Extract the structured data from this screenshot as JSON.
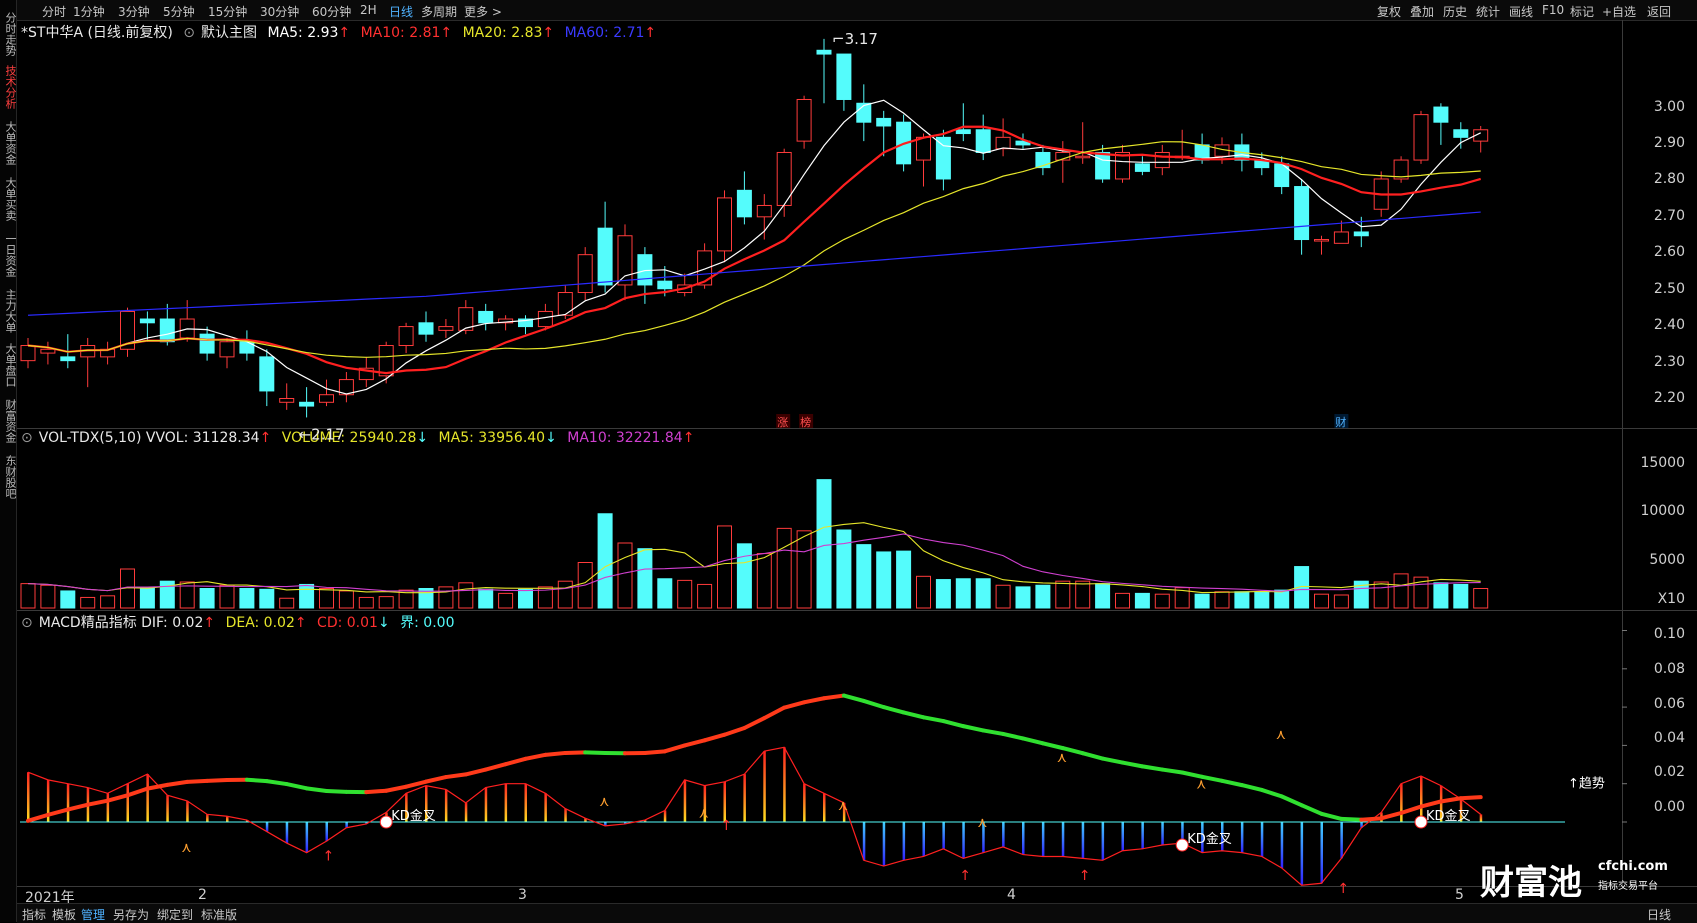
{
  "sidebar": {
    "items": [
      {
        "label": "分时走势",
        "active": false
      },
      {
        "label": "技术分析",
        "active": true
      },
      {
        "label": "大单资金",
        "active": false
      },
      {
        "label": "大单买卖",
        "active": false
      },
      {
        "label": "一日资金",
        "active": false
      },
      {
        "label": "主力大单",
        "active": false
      },
      {
        "label": "大单盘口",
        "active": false
      },
      {
        "label": "财富资金",
        "active": false
      },
      {
        "label": "东财股吧",
        "active": false
      }
    ]
  },
  "toolbar": {
    "periods": [
      "分时",
      "1分钟",
      "3分钟",
      "5分钟",
      "15分钟",
      "30分钟",
      "60分钟",
      "2H",
      "日线",
      "多周期",
      "更多 >"
    ],
    "active_period": "日线",
    "right_items": [
      "复权",
      "叠加",
      "历史",
      "统计",
      "画线",
      "F10",
      "标记",
      "+自选",
      "返回"
    ]
  },
  "main_chart": {
    "stock_title": "*ST中华A (日线.前复权)",
    "indicator_name": "默认主图",
    "ma5": "MA5: 2.93",
    "ma10": "MA10: 2.81",
    "ma20": "MA20: 2.83",
    "ma60": "MA60: 2.71",
    "high_label": "3.17",
    "low_label": "2.17",
    "markers": [
      "涨",
      "榜",
      "财"
    ],
    "y_ticks": [
      "3.00",
      "2.90",
      "2.80",
      "2.70",
      "2.60",
      "2.50",
      "2.40",
      "2.30",
      "2.20"
    ]
  },
  "volume_chart": {
    "indicator": "VOL-TDX(5,10) VVOL: 31128.34",
    "volume": "VOLUME: 25940.28",
    "ma5": "MA5: 33956.40",
    "ma10": "MA10: 32221.84",
    "y_ticks": [
      "15000",
      "10000",
      "5000",
      "X10"
    ]
  },
  "macd_chart": {
    "indicator": "MACD精品指标 DIF: 0.02",
    "dea": "DEA: 0.02",
    "cd": "CD: 0.01",
    "jie": "界: 0.00",
    "kd_label": "KD金叉",
    "trend_label": "趋势",
    "y_ticks": [
      "0.10",
      "0.08",
      "0.06",
      "0.04",
      "0.02",
      "0.00"
    ]
  },
  "time_axis": [
    "2021年",
    "2",
    "3",
    "4",
    "5"
  ],
  "bottombar": {
    "items": [
      "指标",
      "模板",
      "管理",
      "另存为",
      "绑定到",
      "标准版"
    ],
    "active": "管理",
    "period_label": "日线"
  },
  "watermark": {
    "brand": "财富池",
    "site": "cfchi.com",
    "tagline": "指标交易平台"
  },
  "colors": {
    "up": "#ff3b3b",
    "down": "#54fcfc",
    "ma5": "#ffffff",
    "ma10": "#ff2020",
    "ma20": "#e5e52a",
    "ma60": "#2a2aff",
    "vol_ma10": "#d040d0",
    "blue_label": "#4fb2ff"
  },
  "chart_data": {
    "type": "candlestick",
    "candles": [
      [
        2.32,
        2.36,
        2.38,
        2.3
      ],
      [
        2.34,
        2.35,
        2.37,
        2.31
      ],
      [
        2.33,
        2.32,
        2.39,
        2.3
      ],
      [
        2.33,
        2.36,
        2.38,
        2.25
      ],
      [
        2.33,
        2.35,
        2.37,
        2.31
      ],
      [
        2.35,
        2.45,
        2.46,
        2.33
      ],
      [
        2.43,
        2.42,
        2.45,
        2.37
      ],
      [
        2.43,
        2.37,
        2.47,
        2.36
      ],
      [
        2.38,
        2.43,
        2.48,
        2.37
      ],
      [
        2.39,
        2.34,
        2.41,
        2.32
      ],
      [
        2.33,
        2.37,
        2.38,
        2.3
      ],
      [
        2.37,
        2.34,
        2.4,
        2.32
      ],
      [
        2.33,
        2.24,
        2.35,
        2.2
      ],
      [
        2.21,
        2.22,
        2.26,
        2.19
      ],
      [
        2.21,
        2.2,
        2.25,
        2.17
      ],
      [
        2.21,
        2.23,
        2.27,
        2.2
      ],
      [
        2.23,
        2.27,
        2.29,
        2.21
      ],
      [
        2.27,
        2.3,
        2.33,
        2.25
      ],
      [
        2.28,
        2.36,
        2.37,
        2.26
      ],
      [
        2.36,
        2.41,
        2.42,
        2.34
      ],
      [
        2.42,
        2.39,
        2.45,
        2.37
      ],
      [
        2.4,
        2.41,
        2.43,
        2.38
      ],
      [
        2.4,
        2.46,
        2.48,
        2.39
      ],
      [
        2.45,
        2.42,
        2.47,
        2.4
      ],
      [
        2.42,
        2.43,
        2.44,
        2.4
      ],
      [
        2.43,
        2.41,
        2.44,
        2.39
      ],
      [
        2.41,
        2.45,
        2.47,
        2.4
      ],
      [
        2.44,
        2.5,
        2.52,
        2.43
      ],
      [
        2.5,
        2.6,
        2.62,
        2.48
      ],
      [
        2.67,
        2.52,
        2.74,
        2.5
      ],
      [
        2.52,
        2.65,
        2.68,
        2.48
      ],
      [
        2.6,
        2.52,
        2.62,
        2.47
      ],
      [
        2.53,
        2.51,
        2.57,
        2.49
      ],
      [
        2.5,
        2.52,
        2.55,
        2.49
      ],
      [
        2.52,
        2.61,
        2.63,
        2.51
      ],
      [
        2.61,
        2.75,
        2.77,
        2.58
      ],
      [
        2.77,
        2.7,
        2.82,
        2.68
      ],
      [
        2.7,
        2.73,
        2.76,
        2.64
      ],
      [
        2.73,
        2.87,
        2.88,
        2.7
      ],
      [
        2.9,
        3.01,
        3.02,
        2.88
      ],
      [
        3.14,
        3.13,
        3.17,
        3.0
      ],
      [
        3.13,
        3.01,
        3.13,
        2.98
      ],
      [
        3.0,
        2.95,
        3.05,
        2.9
      ],
      [
        2.96,
        2.94,
        2.98,
        2.86
      ],
      [
        2.95,
        2.84,
        2.97,
        2.82
      ],
      [
        2.85,
        2.91,
        2.92,
        2.78
      ],
      [
        2.91,
        2.8,
        2.93,
        2.77
      ],
      [
        2.93,
        2.92,
        3.0,
        2.9
      ],
      [
        2.93,
        2.87,
        2.97,
        2.85
      ],
      [
        2.88,
        2.91,
        2.96,
        2.86
      ],
      [
        2.9,
        2.89,
        2.92,
        2.88
      ],
      [
        2.87,
        2.83,
        2.89,
        2.81
      ],
      [
        2.85,
        2.87,
        2.9,
        2.79
      ],
      [
        2.86,
        2.86,
        2.95,
        2.84
      ],
      [
        2.87,
        2.8,
        2.89,
        2.79
      ],
      [
        2.8,
        2.87,
        2.89,
        2.79
      ],
      [
        2.84,
        2.82,
        2.86,
        2.81
      ],
      [
        2.83,
        2.87,
        2.89,
        2.81
      ],
      [
        2.86,
        2.86,
        2.93,
        2.85
      ],
      [
        2.89,
        2.85,
        2.92,
        2.84
      ],
      [
        2.86,
        2.89,
        2.91,
        2.84
      ],
      [
        2.89,
        2.85,
        2.92,
        2.82
      ],
      [
        2.85,
        2.83,
        2.87,
        2.81
      ],
      [
        2.84,
        2.78,
        2.86,
        2.76
      ],
      [
        2.78,
        2.64,
        2.8,
        2.6
      ],
      [
        2.64,
        2.64,
        2.65,
        2.6
      ],
      [
        2.63,
        2.66,
        2.69,
        2.63
      ],
      [
        2.66,
        2.65,
        2.7,
        2.62
      ],
      [
        2.72,
        2.8,
        2.82,
        2.7
      ],
      [
        2.8,
        2.85,
        2.86,
        2.79
      ],
      [
        2.85,
        2.97,
        2.98,
        2.84
      ],
      [
        2.99,
        2.95,
        3.0,
        2.89
      ],
      [
        2.93,
        2.91,
        2.95,
        2.88
      ],
      [
        2.9,
        2.93,
        2.94,
        2.87
      ]
    ],
    "volume_total": [
      3000,
      2800,
      2100,
      1300,
      1500,
      4800,
      2500,
      3300,
      3200,
      2400,
      2800,
      2400,
      2300,
      1200,
      2900,
      2400,
      2100,
      1300,
      1400,
      2200,
      2400,
      2600,
      3100,
      2300,
      1800,
      2300,
      2600,
      3300,
      5600,
      11600,
      8000,
      7300,
      3600,
      3400,
      2900,
      10100,
      7900,
      6700,
      9800,
      9500,
      15800,
      9600,
      7800,
      6900,
      7000,
      3900,
      3500,
      3600,
      3600,
      2800,
      2600,
      2800,
      3300,
      3300,
      3000,
      1800,
      1800,
      1700,
      2500,
      1700,
      2000,
      2000,
      2000,
      2200,
      5100,
      1700,
      1600,
      3300,
      3200,
      4200,
      3800,
      3100,
      2900,
      2400
    ],
    "vol_ma5_labels": [
      "5000",
      "10000",
      "15000"
    ],
    "macd_hist": [
      0.026,
      0.022,
      0.02,
      0.018,
      0.015,
      0.02,
      0.025,
      0.014,
      0.011,
      0.004,
      0.003,
      0.001,
      -0.005,
      -0.011,
      -0.016,
      -0.01,
      -0.003,
      -0.001,
      0.005,
      0.015,
      0.019,
      0.017,
      0.01,
      0.018,
      0.02,
      0.02,
      0.015,
      0.007,
      0.002,
      -0.002,
      -0.001,
      0.001,
      0.006,
      0.022,
      0.019,
      0.021,
      0.025,
      0.037,
      0.039,
      0.02,
      0.015,
      0.01,
      -0.02,
      -0.023,
      -0.02,
      -0.018,
      -0.014,
      -0.019,
      -0.016,
      -0.013,
      -0.017,
      -0.018,
      -0.018,
      -0.019,
      -0.02,
      -0.015,
      -0.014,
      -0.012,
      -0.011,
      -0.016,
      -0.015,
      -0.016,
      -0.018,
      -0.024,
      -0.033,
      -0.032,
      -0.019,
      -0.003,
      0.005,
      0.02,
      0.024,
      0.019,
      0.012,
      0.004
    ],
    "ylim_price": [
      2.15,
      3.22
    ],
    "ylim_volume": [
      0,
      16000
    ],
    "ylim_macd": [
      -0.035,
      0.1
    ]
  }
}
